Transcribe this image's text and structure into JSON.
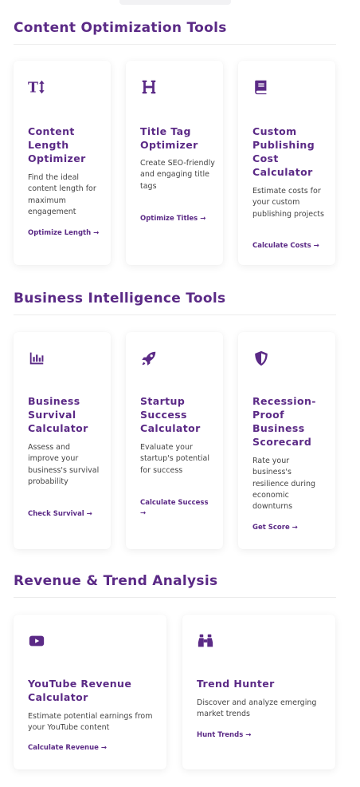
{
  "colors": {
    "accent": "#5b2a86",
    "text": "#444444",
    "rule": "#ececec"
  },
  "sections": [
    {
      "title": "Content Optimization Tools",
      "cards": [
        {
          "icon": "text-height-icon",
          "title": "Content Length Optimizer",
          "description": "Find the ideal content length for maximum engagement",
          "link": "Optimize Length →"
        },
        {
          "icon": "heading-icon",
          "title": "Title Tag Optimizer",
          "description": "Create SEO-friendly and engaging title tags",
          "link": "Optimize Titles →"
        },
        {
          "icon": "book-icon",
          "title": "Custom Publishing Cost Calculator",
          "description": "Estimate costs for your custom publishing projects",
          "link": "Calculate Costs →"
        }
      ]
    },
    {
      "title": "Business Intelligence Tools",
      "cards": [
        {
          "icon": "chart-bar-icon",
          "title": "Business Survival Calculator",
          "description": "Assess and improve your business's survival probability",
          "link": "Check Survival →"
        },
        {
          "icon": "rocket-icon",
          "title": "Startup Success Calculator",
          "description": "Evaluate your startup's potential for success",
          "link": "Calculate Success →"
        },
        {
          "icon": "shield-icon",
          "title": "Recession-Proof Business Scorecard",
          "description": "Rate your business's resilience during economic downturns",
          "link": "Get Score →"
        }
      ]
    },
    {
      "title": "Revenue & Trend Analysis",
      "cards": [
        {
          "icon": "youtube-icon",
          "title": "YouTube Revenue Calculator",
          "description": "Estimate potential earnings from your YouTube content",
          "link": "Calculate Revenue →"
        },
        {
          "icon": "binoculars-icon",
          "title": "Trend Hunter",
          "description": "Discover and analyze emerging market trends",
          "link": "Hunt Trends →"
        }
      ]
    }
  ]
}
